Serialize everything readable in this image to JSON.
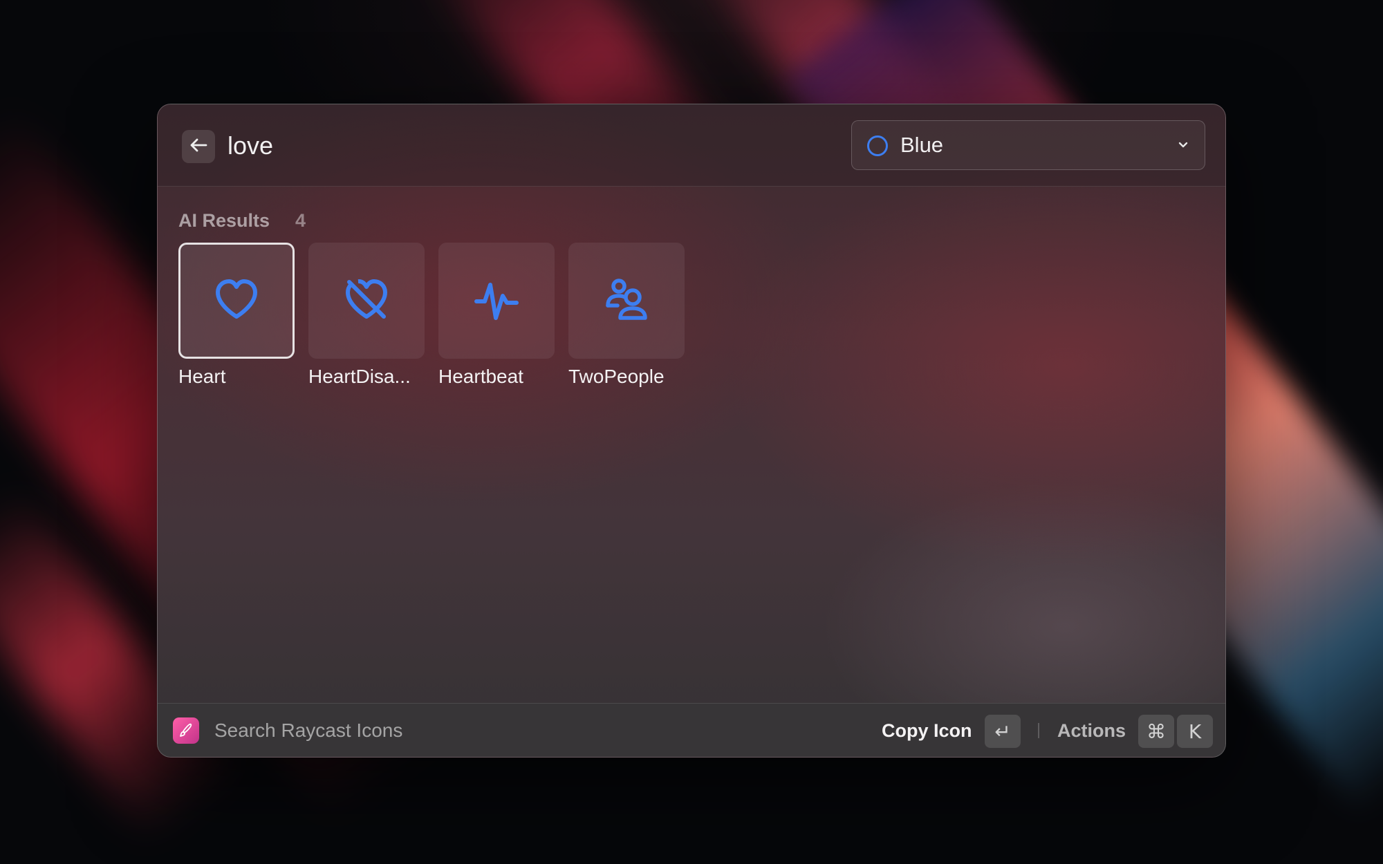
{
  "header": {
    "search_value": "love",
    "color_select": {
      "label": "Blue",
      "color": "#3d7ef0"
    }
  },
  "section": {
    "title": "AI Results",
    "count": "4"
  },
  "results": [
    {
      "label": "Heart",
      "icon": "heart-icon",
      "selected": true
    },
    {
      "label": "HeartDisa...",
      "icon": "heart-disabled-icon",
      "selected": false
    },
    {
      "label": "Heartbeat",
      "icon": "heartbeat-icon",
      "selected": false
    },
    {
      "label": "TwoPeople",
      "icon": "two-people-icon",
      "selected": false
    }
  ],
  "footer": {
    "title": "Search Raycast Icons",
    "primary_action": "Copy Icon",
    "primary_key": "↵",
    "actions_label": "Actions",
    "actions_keys": [
      "⌘",
      "K"
    ]
  },
  "colors": {
    "accent": "#3d7ef0",
    "app_icon": "#e0459a"
  }
}
